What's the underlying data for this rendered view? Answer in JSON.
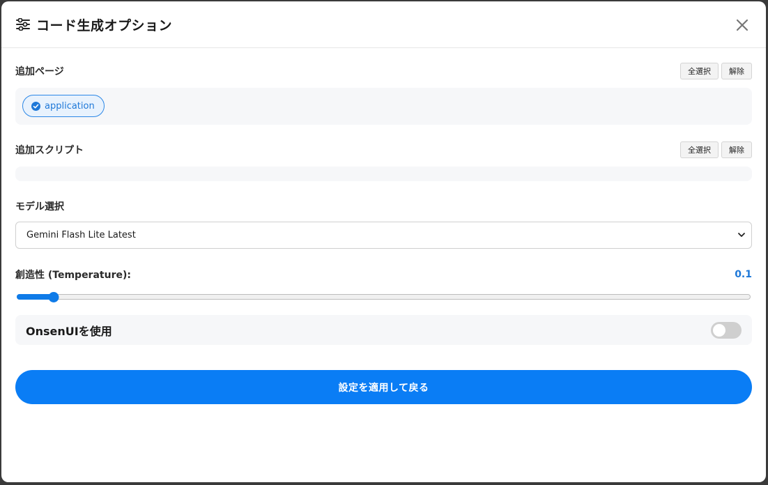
{
  "header": {
    "title": "コード生成オプション",
    "icon": "sliders-icon",
    "close_icon": "close-icon"
  },
  "pages": {
    "label": "追加ページ",
    "select_all": "全選択",
    "clear": "解除",
    "items": [
      {
        "label": "application",
        "selected": true
      }
    ]
  },
  "scripts": {
    "label": "追加スクリプト",
    "select_all": "全選択",
    "clear": "解除",
    "items": []
  },
  "model": {
    "label": "モデル選択",
    "selected": "Gemini Flash Lite Latest"
  },
  "temperature": {
    "label": "創造性 (Temperature):",
    "value_text": "0.1",
    "value": 0.1,
    "min": 0,
    "max": 2
  },
  "onsen": {
    "label": "OnsenUIを使用",
    "enabled": false
  },
  "apply": {
    "label": "設定を適用して戻る"
  },
  "colors": {
    "accent": "#0a7df5",
    "chip_border": "#2b87e6",
    "panel_bg": "#f6f7f9"
  }
}
